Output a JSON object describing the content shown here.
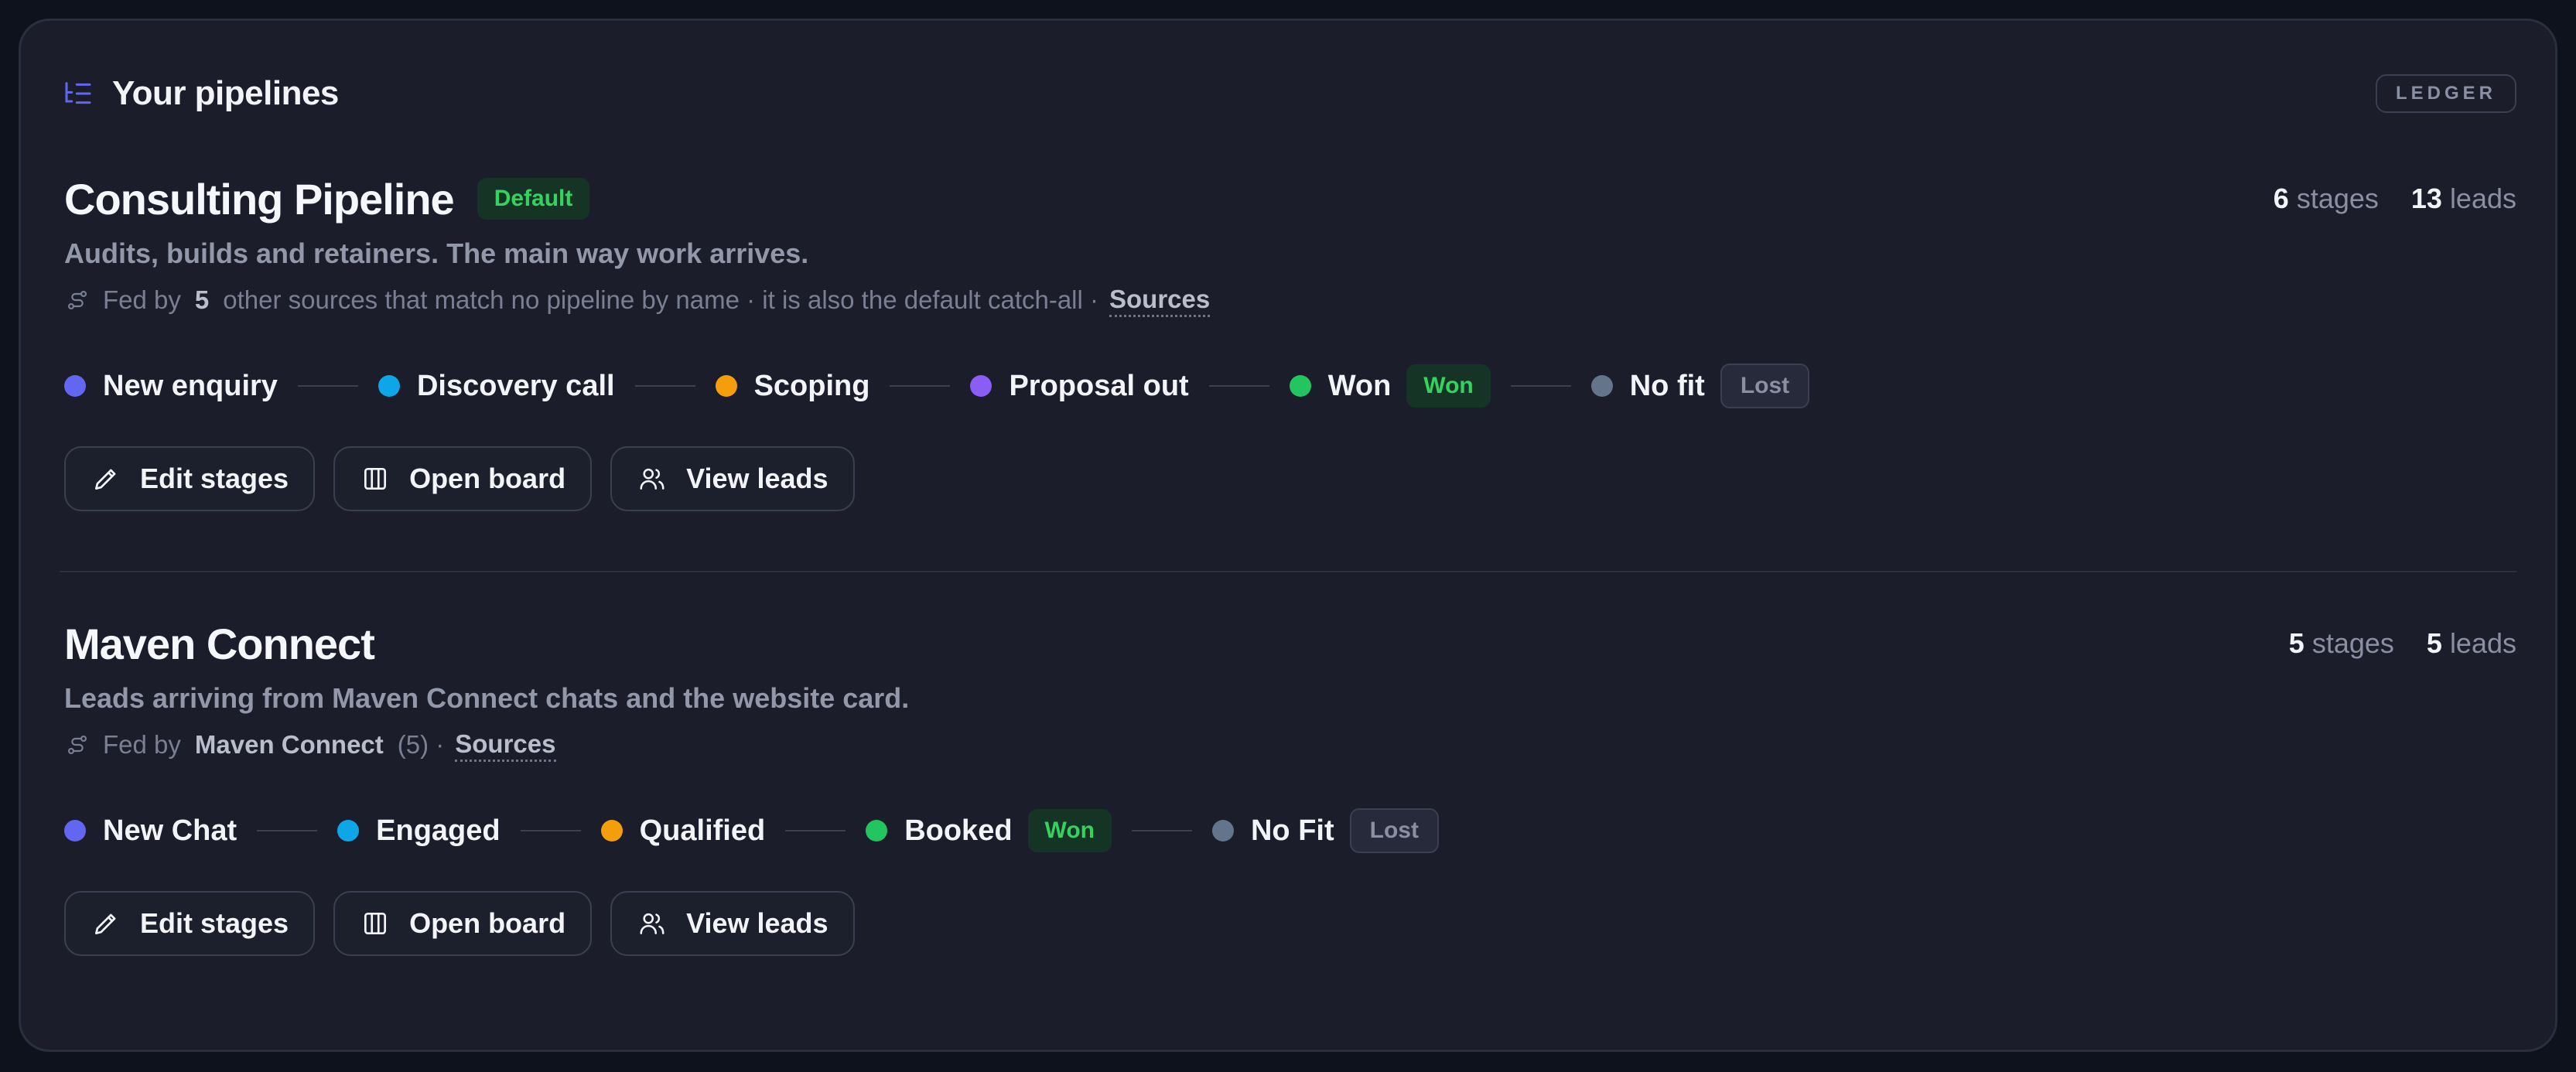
{
  "header": {
    "title": "Your pipelines",
    "badge": "LEDGER",
    "icon": "list-tree-icon"
  },
  "pipelines": [
    {
      "title": "Consulting Pipeline",
      "default_badge": "Default",
      "stats": {
        "stages_count": "6",
        "stages_label": "stages",
        "leads_count": "13",
        "leads_label": "leads"
      },
      "description": "Audits, builds and retainers. The main way work arrives.",
      "fed": {
        "icon": "route-icon",
        "label": "Fed by",
        "strong": "5",
        "text": "other sources that match no pipeline by name · it is also the default catch-all ·",
        "sources_link": "Sources"
      },
      "stages": [
        {
          "name": "New enquiry",
          "color": "#6366f1"
        },
        {
          "name": "Discovery call",
          "color": "#0ea5e9"
        },
        {
          "name": "Scoping",
          "color": "#f59e0b"
        },
        {
          "name": "Proposal out",
          "color": "#8b5cf6"
        },
        {
          "name": "Won",
          "color": "#22c55e",
          "tag": "Won"
        },
        {
          "name": "No fit",
          "color": "#64748b",
          "tag": "Lost"
        }
      ],
      "actions": {
        "edit": "Edit stages",
        "board": "Open board",
        "leads": "View leads"
      }
    },
    {
      "title": "Maven Connect",
      "stats": {
        "stages_count": "5",
        "stages_label": "stages",
        "leads_count": "5",
        "leads_label": "leads"
      },
      "description": "Leads arriving from Maven Connect chats and the website card.",
      "fed": {
        "icon": "route-icon",
        "label": "Fed by",
        "strong": "Maven Connect",
        "count": "(5) ·",
        "sources_link": "Sources"
      },
      "stages": [
        {
          "name": "New Chat",
          "color": "#6366f1"
        },
        {
          "name": "Engaged",
          "color": "#0ea5e9"
        },
        {
          "name": "Qualified",
          "color": "#f59e0b"
        },
        {
          "name": "Booked",
          "color": "#22c55e",
          "tag": "Won"
        },
        {
          "name": "No Fit",
          "color": "#64748b",
          "tag": "Lost"
        }
      ],
      "actions": {
        "edit": "Edit stages",
        "board": "Open board",
        "leads": "View leads"
      }
    }
  ],
  "colors": {
    "won_tag_bg": "#163426",
    "won_tag_text": "#34d35f",
    "panel_bg": "#1b1e2a",
    "page_bg": "#0d121d"
  }
}
